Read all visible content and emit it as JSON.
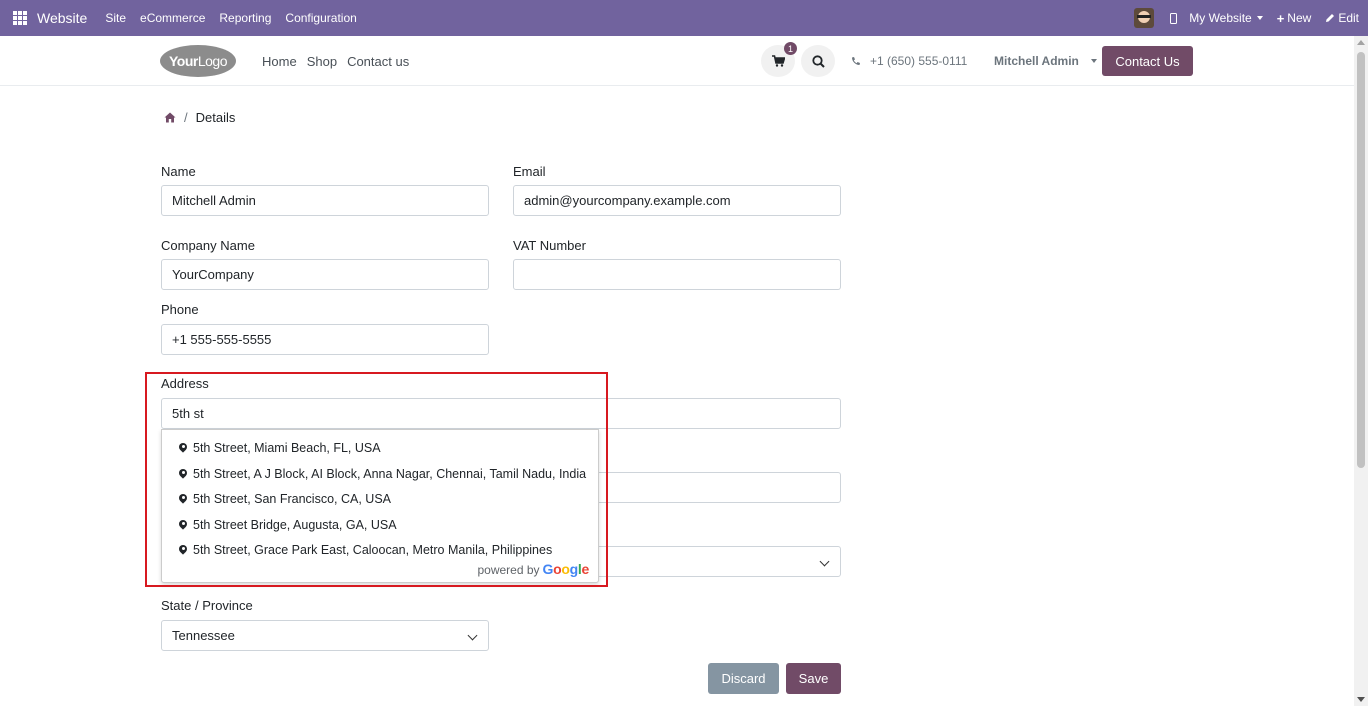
{
  "topbar": {
    "brand": "Website",
    "menu": [
      "Site",
      "eCommerce",
      "Reporting",
      "Configuration"
    ],
    "my_website": "My Website",
    "new_label": "New",
    "edit_label": "Edit"
  },
  "header": {
    "logo_bold": "Your",
    "logo_thin": "Logo",
    "nav": [
      "Home",
      "Shop",
      "Contact us"
    ],
    "cart_count": "1",
    "phone": "+1 (650) 555-0111",
    "user": "Mitchell Admin",
    "contact_button": "Contact Us"
  },
  "breadcrumb": {
    "current": "Details"
  },
  "form": {
    "name_label": "Name",
    "name_value": "Mitchell Admin",
    "email_label": "Email",
    "email_value": "admin@yourcompany.example.com",
    "company_label": "Company Name",
    "company_value": "YourCompany",
    "vat_label": "VAT Number",
    "vat_value": "",
    "phone_label": "Phone",
    "phone_value": "+1 555-555-5555",
    "address_label": "Address",
    "address_value": "5th st",
    "state_label": "State / Province",
    "state_value": "Tennessee"
  },
  "autocomplete": {
    "items": [
      "5th Street, Miami Beach, FL, USA",
      "5th Street, A J Block, AI Block, Anna Nagar, Chennai, Tamil Nadu, India",
      "5th Street, San Francisco, CA, USA",
      "5th Street Bridge, Augusta, GA, USA",
      "5th Street, Grace Park East, Caloocan, Metro Manila, Philippines"
    ],
    "powered_by": "powered by",
    "google": [
      "G",
      "o",
      "o",
      "g",
      "l",
      "e"
    ]
  },
  "actions": {
    "discard": "Discard",
    "save": "Save"
  },
  "colors": {
    "topbar": "#71639e",
    "primary": "#714b67",
    "secondary": "#8595a2",
    "highlight": "#d71920"
  }
}
